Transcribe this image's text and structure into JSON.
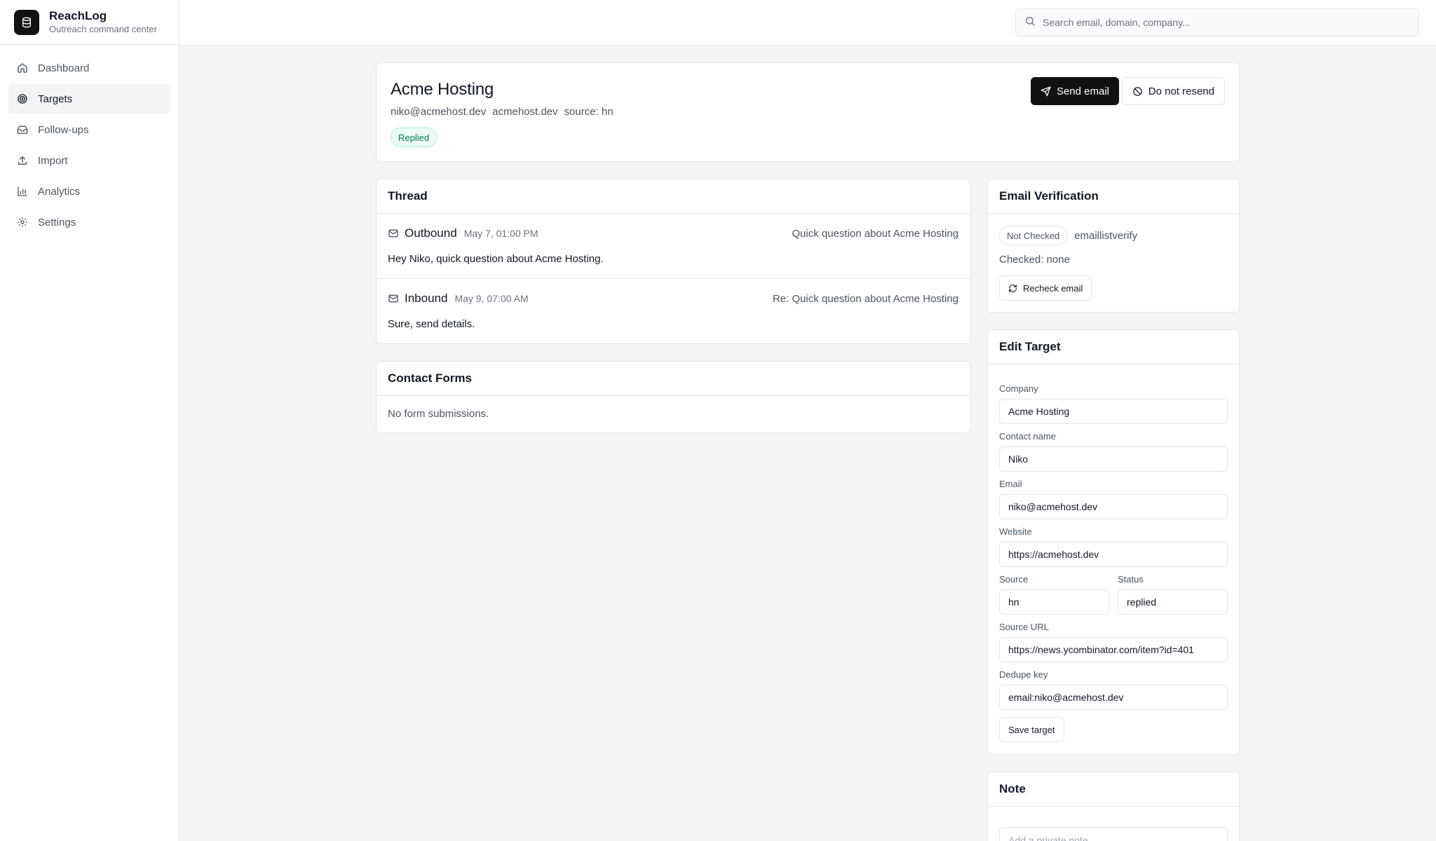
{
  "brand": {
    "name": "ReachLog",
    "tagline": "Outreach command center"
  },
  "sidebar": {
    "items": [
      {
        "label": "Dashboard",
        "icon": "home-icon"
      },
      {
        "label": "Targets",
        "icon": "target-icon",
        "active": true
      },
      {
        "label": "Follow-ups",
        "icon": "inbox-icon"
      },
      {
        "label": "Import",
        "icon": "upload-icon"
      },
      {
        "label": "Analytics",
        "icon": "bar-chart-icon"
      },
      {
        "label": "Settings",
        "icon": "gear-icon"
      }
    ]
  },
  "search": {
    "placeholder": "Search email, domain, company..."
  },
  "target": {
    "title": "Acme Hosting",
    "email": "niko@acmehost.dev",
    "domain": "acmehost.dev",
    "source": "source: hn",
    "status_badge": "Replied",
    "send_label": "Send email",
    "dnr_label": "Do not resend"
  },
  "thread": {
    "title": "Thread",
    "messages": [
      {
        "direction": "Outbound",
        "date": "May 7, 01:00 PM",
        "subject": "Quick question about Acme Hosting",
        "body": "Hey Niko, quick question about Acme Hosting."
      },
      {
        "direction": "Inbound",
        "date": "May 9, 07:00 AM",
        "subject": "Re: Quick question about Acme Hosting",
        "body": "Sure, send details."
      }
    ]
  },
  "contact_forms": {
    "title": "Contact Forms",
    "empty": "No form submissions."
  },
  "verification": {
    "title": "Email Verification",
    "status": "Not Checked",
    "provider": "emaillistverify",
    "checked": "Checked: none",
    "recheck_label": "Recheck email"
  },
  "edit": {
    "title": "Edit Target",
    "company_label": "Company",
    "company": "Acme Hosting",
    "contact_label": "Contact name",
    "contact": "Niko",
    "email_label": "Email",
    "email": "niko@acmehost.dev",
    "website_label": "Website",
    "website": "https://acmehost.dev",
    "source_label": "Source",
    "source": "hn",
    "status_label": "Status",
    "status": "replied",
    "source_url_label": "Source URL",
    "source_url": "https://news.ycombinator.com/item?id=401",
    "dedupe_label": "Dedupe key",
    "dedupe": "email:niko@acmehost.dev",
    "save_label": "Save target"
  },
  "note": {
    "title": "Note",
    "placeholder": "Add a private note..."
  },
  "colors": {
    "accent": "#111111",
    "success_bg": "#ecfdf5",
    "success_text": "#047857",
    "border": "#e5e7eb",
    "background": "#f3f4f6"
  }
}
